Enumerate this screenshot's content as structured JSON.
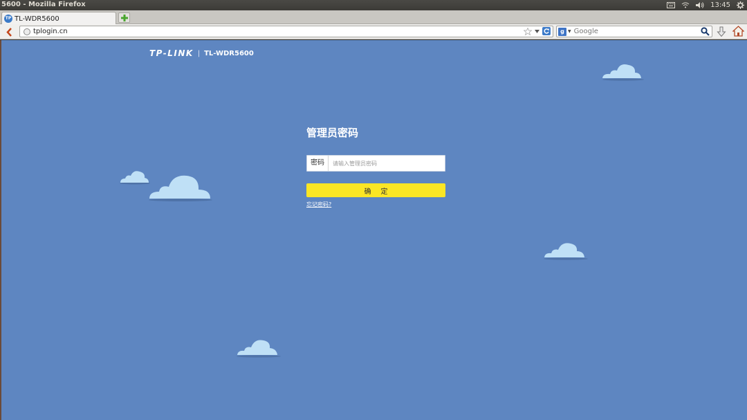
{
  "window": {
    "title": "5600 - Mozilla Firefox"
  },
  "panel": {
    "time": "13:45",
    "icons": [
      "keyboard-icon",
      "wifi-icon",
      "volume-icon",
      "gear-icon"
    ]
  },
  "browser": {
    "tab_title": "TL-WDR5600",
    "tab_favicon": "TP",
    "url": "tplogin.cn",
    "search_engine": "g",
    "search_placeholder": "Google"
  },
  "page": {
    "brand_logo": "TP-LINK",
    "brand_separator": "|",
    "brand_model": "TL-WDR5600",
    "title": "管理员密码",
    "password_label": "密码",
    "password_placeholder": "请输入管理员密码",
    "confirm_label": "确定",
    "forgot_link": "忘记密码?"
  },
  "colors": {
    "page_background": "#5e86c1",
    "confirm_button": "#fbe625",
    "cloud": "#bfe0f6"
  }
}
